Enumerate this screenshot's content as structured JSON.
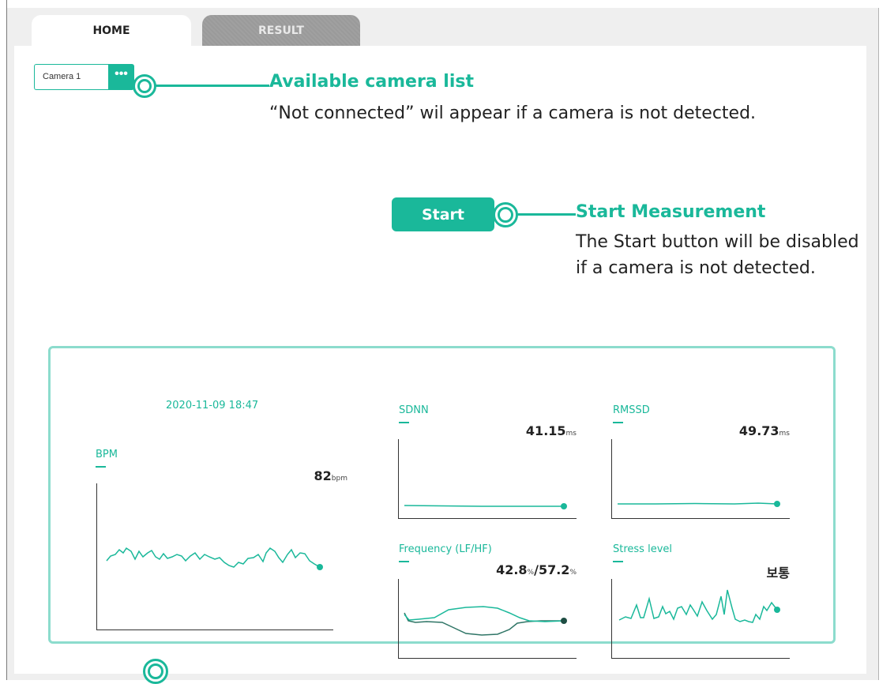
{
  "tabs": [
    {
      "label": "HOME",
      "active": true
    },
    {
      "label": "RESULT",
      "active": false
    }
  ],
  "camera": {
    "selected": "Camera 1",
    "more_button_label": "•••"
  },
  "notes": {
    "camera_list": {
      "title": "Available camera list",
      "text": "“Not connected” wil appear if a camera is not detected."
    },
    "start": {
      "title": "Start Measurement",
      "line1": "The Start button will be disabled",
      "line2": "if a camera is not detected."
    }
  },
  "start_button": {
    "label": "Start"
  },
  "results": {
    "timestamp": "2020-11-09 18:47",
    "bpm": {
      "label": "BPM",
      "value": "82",
      "unit": "bpm"
    },
    "sdnn": {
      "label": "SDNN",
      "value": "41.15",
      "unit": "ms"
    },
    "rmssd": {
      "label": "RMSSD",
      "value": "49.73",
      "unit": "ms"
    },
    "frequency": {
      "label": "Frequency (LF/HF)",
      "lf": "42.8",
      "hf": "57.2",
      "unit": "%",
      "sep": "/"
    },
    "stress": {
      "label": "Stress level",
      "value": "보통"
    }
  },
  "colors": {
    "accent": "#1ab89a",
    "accent_light": "#8cdccd",
    "tab_inactive": "#9a9a9a",
    "background": "#efefef"
  }
}
